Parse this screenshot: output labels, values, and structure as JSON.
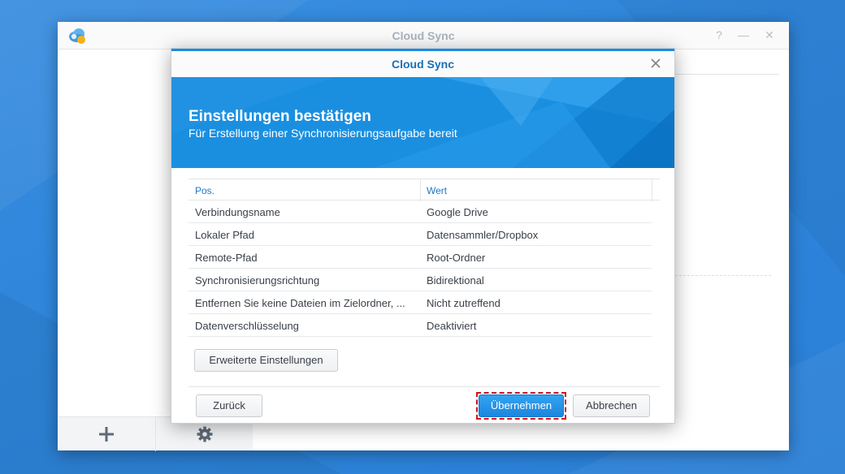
{
  "app": {
    "title": "Cloud Sync",
    "logo_icon": "cloud-sync-logo-icon",
    "window_controls": [
      "help-icon",
      "minimize-icon",
      "close-icon"
    ],
    "sidebar_buttons": [
      "add-icon",
      "gear-icon"
    ]
  },
  "dialog": {
    "title": "Cloud Sync",
    "banner": {
      "title": "Einstellungen bestätigen",
      "subtitle": "Für Erstellung einer Synchronisierungsaufgabe bereit"
    },
    "table": {
      "headers": [
        "Pos.",
        "Wert"
      ],
      "rows": [
        [
          "Verbindungsname",
          "Google Drive"
        ],
        [
          "Lokaler Pfad",
          "Datensammler/Dropbox"
        ],
        [
          "Remote-Pfad",
          "Root-Ordner"
        ],
        [
          "Synchronisierungsrichtung",
          "Bidirektional"
        ],
        [
          "Entfernen Sie keine Dateien im Zielordner, ...",
          "Nicht zutreffend"
        ],
        [
          "Datenverschlüsselung",
          "Deaktiviert"
        ]
      ]
    },
    "advanced_button": "Erweiterte Einstellungen",
    "back_button": "Zurück",
    "apply_button": "Übernehmen",
    "cancel_button": "Abbrechen"
  },
  "colors": {
    "accent": "#1a8fe0",
    "header_text": "#1e78c8",
    "highlight_border": "#d0141c"
  }
}
